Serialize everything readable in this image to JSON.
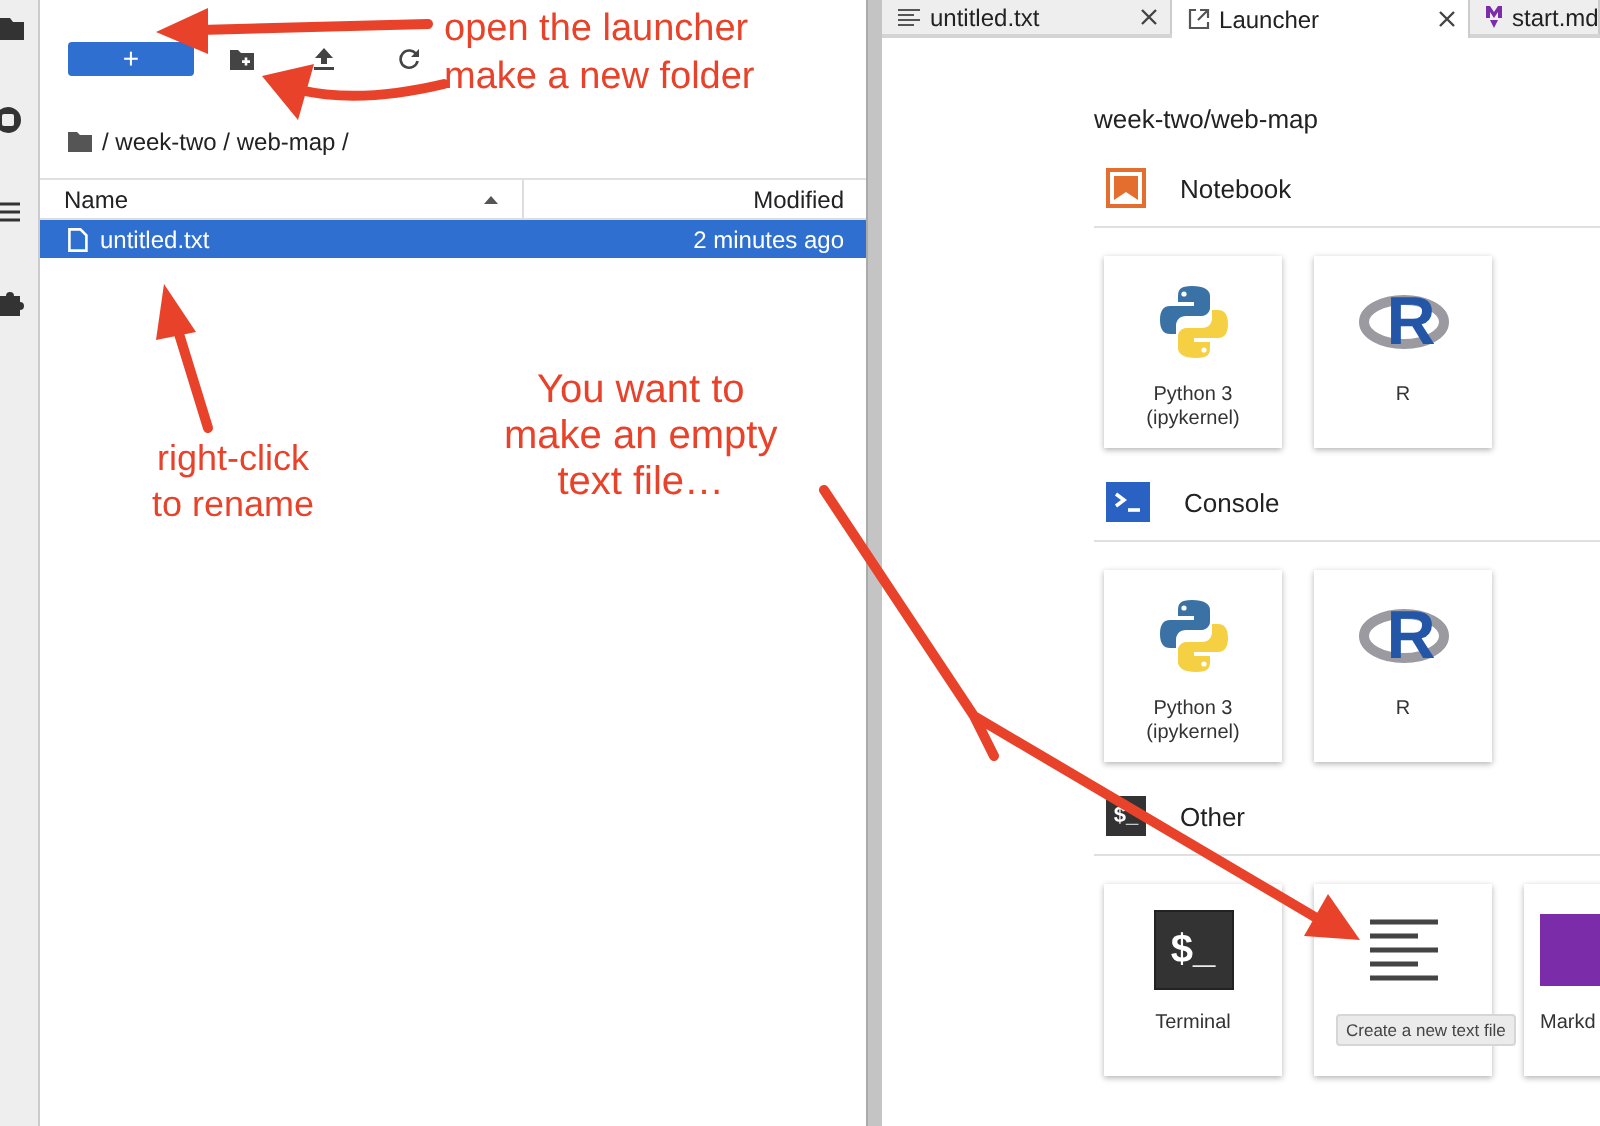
{
  "file_browser": {
    "new_button": "+",
    "breadcrumb": "/ week-two / web-map /",
    "columns": [
      {
        "label": "Name",
        "sorted": true
      },
      {
        "label": "Modified",
        "sorted": false
      }
    ],
    "rows": [
      {
        "name": "untitled.txt",
        "modified": "2 minutes ago",
        "selected": true
      }
    ]
  },
  "tabs": [
    {
      "label": "untitled.txt",
      "kind": "text",
      "selected": false
    },
    {
      "label": "Launcher",
      "kind": "launcher",
      "selected": true
    },
    {
      "label": "start.md",
      "kind": "markdown",
      "selected": false
    }
  ],
  "launcher": {
    "path": "week-two/web-map",
    "sections": [
      {
        "title": "Notebook",
        "kind": "notebook",
        "cards": [
          {
            "kind": "python",
            "label": "Python 3 (ipykernel)"
          },
          {
            "kind": "r",
            "label": "R",
            "logo_text": "R"
          }
        ]
      },
      {
        "title": "Console",
        "kind": "console",
        "cards": [
          {
            "kind": "python",
            "label": "Python 3 (ipykernel)"
          },
          {
            "kind": "r",
            "label": "R",
            "logo_text": "R"
          }
        ]
      },
      {
        "title": "Other",
        "kind": "other",
        "icon_text": "$_",
        "cards": [
          {
            "kind": "terminal",
            "label": "Terminal",
            "logo_text": "$_"
          },
          {
            "kind": "text"
          },
          {
            "kind": "markdown",
            "label": "Markd"
          }
        ]
      }
    ]
  },
  "tooltip": "Create a new text file",
  "annotations": [
    {
      "text": "open the launcher"
    },
    {
      "text": "make a new folder"
    },
    {
      "text": "right-click\nto rename"
    },
    {
      "text": "You want to\nmake an empty\ntext file…"
    }
  ]
}
